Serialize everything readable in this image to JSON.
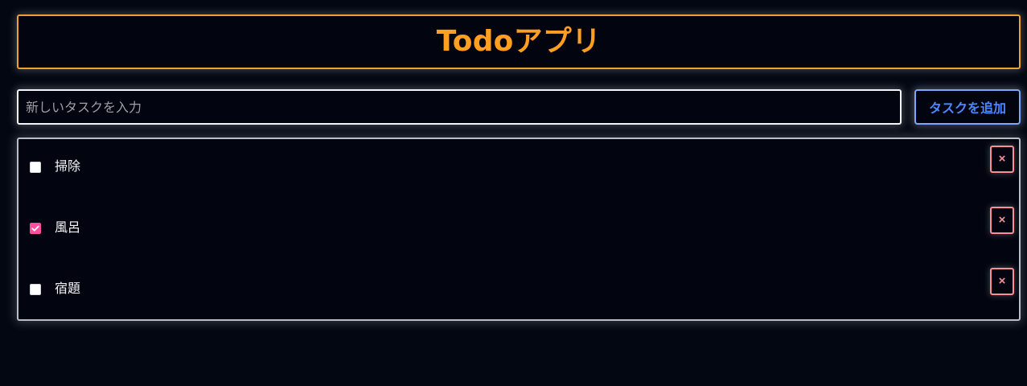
{
  "app": {
    "title": "Todoアプリ"
  },
  "input": {
    "placeholder": "新しいタスクを入力",
    "value": ""
  },
  "actions": {
    "add_label": "タスクを追加"
  },
  "tasks": [
    {
      "label": "掃除",
      "checked": false,
      "delete_label": "×"
    },
    {
      "label": "風呂",
      "checked": true,
      "delete_label": "×"
    },
    {
      "label": "宿題",
      "checked": false,
      "delete_label": "×"
    }
  ],
  "colors": {
    "background": "#030712",
    "title": "#ff9e1f",
    "header_border": "#f0a030",
    "input_border": "#f3f4f6",
    "add_button_border": "#7aa7ff",
    "add_button_text": "#4d86ff",
    "list_border": "#b8bec4",
    "checked_box": "#ff4fa0",
    "delete_border": "#ff8d98"
  },
  "icons": {
    "checkbox_checked": "checkmark-icon",
    "delete": "close-icon"
  }
}
